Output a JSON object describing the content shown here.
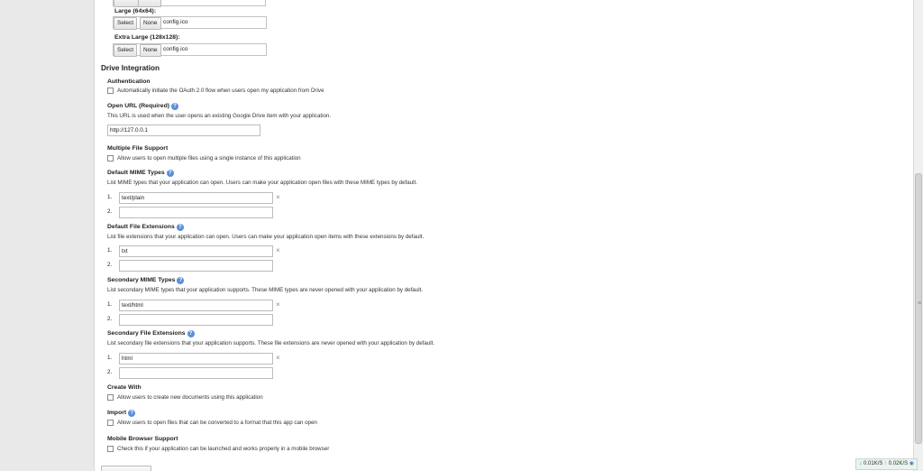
{
  "icons": {
    "top_partial": {
      "value": ""
    },
    "large": {
      "label": "Large (64x64):",
      "select": "Select",
      "none": "None",
      "value": "config.ico"
    },
    "extra_large": {
      "label": "Extra Large (128x128):",
      "select": "Select",
      "none": "None",
      "value": "config.ico"
    }
  },
  "drive": {
    "title": "Drive Integration",
    "authentication": {
      "label": "Authentication",
      "checkbox_text": "Automatically initiate the OAuth 2.0 flow when users open my application from Drive"
    },
    "open_url": {
      "label": "Open URL (Required)",
      "desc": "This URL is used when the user opens an existing Google Drive item with your application.",
      "value": "http://127.0.0.1"
    },
    "multi_file": {
      "label": "Multiple File Support",
      "checkbox_text": "Allow users to open multiple files using a single instance of this application"
    },
    "default_mime": {
      "label": "Default MIME Types",
      "desc": "List MIME types that your application can open. Users can make your application open files with these MIME types by default.",
      "items": [
        "text/plain",
        ""
      ]
    },
    "default_ext": {
      "label": "Default File Extensions",
      "desc": "List file extensions that your application can open. Users can make your application open items with these extensions by default.",
      "items": [
        "txt",
        ""
      ]
    },
    "secondary_mime": {
      "label": "Secondary MIME Types",
      "desc": "List secondary MIME types that your application supports. These MIME types are never opened with your application by default.",
      "items": [
        "text/html",
        ""
      ]
    },
    "secondary_ext": {
      "label": "Secondary File Extensions",
      "desc": "List secondary file extensions that your application supports. These file extensions are never opened with your application by default.",
      "items": [
        "html",
        ""
      ]
    },
    "create_with": {
      "label": "Create With",
      "checkbox_text": "Allow users to create new documents using this application"
    },
    "import": {
      "label": "Import",
      "checkbox_text": "Allow users to open files that can be converted to a format that this app can open"
    },
    "mobile": {
      "label": "Mobile Browser Support",
      "checkbox_text": "Check this if your application can be launched and works properly in a mobile browser"
    }
  },
  "list_numbers": [
    "1.",
    "2."
  ],
  "remove_glyph": "×",
  "help_glyph": "?",
  "status": {
    "down": "0.01K/S",
    "up": "0.02K/S"
  }
}
